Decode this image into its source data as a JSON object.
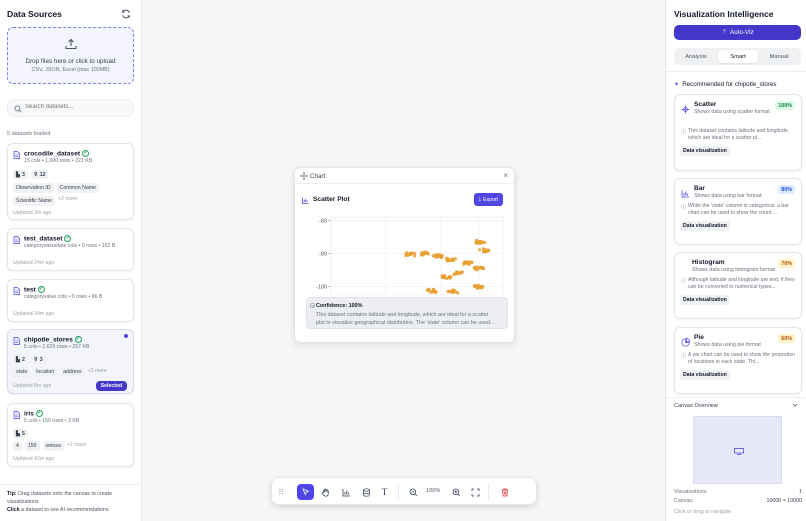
{
  "left_panel": {
    "title": "Data Sources",
    "upload": {
      "text": "Drop files here or click to upload",
      "formats": "CSV, JSON, Excel (max 100MB)"
    },
    "search": {
      "placeholder": "Search datasets..."
    },
    "loaded_count": "5 datasets loaded",
    "datasets": [
      {
        "name": "crocodile_dataset",
        "meta": "15 cols • 1,000 rows • 221 KB",
        "chip_a": "3",
        "chip_b": "12",
        "tags": [
          "Observation ID",
          "Common Name",
          "Scientific Name"
        ],
        "more": "+2 more",
        "updated": "Updated 3m ago"
      },
      {
        "name": "test_dataset",
        "meta": "categoryvaluedate cols • 0 rows • 162 B",
        "updated": "Updated 24m ago"
      },
      {
        "name": "test",
        "meta": "categoryvalue cols • 0 rows • 96 B",
        "updated": "Updated 34m ago"
      },
      {
        "name": "chipotle_stores",
        "meta": "5 cols • 2,629 rows • 257 KB",
        "chip_a": "2",
        "chip_b": "3",
        "tags": [
          "state",
          "location",
          "address"
        ],
        "more": "+2 more",
        "updated": "Updated 8m ago",
        "selected_label": "Selected"
      },
      {
        "name": "iris",
        "meta": "5 cols • 150 rows • 3 KB",
        "chip_a": "5",
        "tags": [
          "4",
          "150",
          "setosa"
        ],
        "more": "+2 more",
        "updated": "Updated 42m ago"
      }
    ],
    "tip_bold": "Tip:",
    "tip_text": " Drag datasets onto the canvas to create visualizations",
    "tip2_bold": "Click",
    "tip2_text": " a dataset to see AI recommendations"
  },
  "chart_window": {
    "title": "Chart",
    "chart_title": "Scatter Plot",
    "export_label": "Export",
    "confidence": "Confidence: 100%",
    "explanation_1": "This dataset contains latitude and longitude, which are ideal for a scatter",
    "explanation_2": "plot to visualize geographical distribution. The 'state' column can be used..."
  },
  "chart_data": {
    "type": "scatter",
    "ylim": [
      -105,
      -58
    ],
    "y_ticks": [
      "-60",
      "-80",
      "-100"
    ],
    "point_color": "#e8a030",
    "clusters": [
      {
        "x": 0.46,
        "y": -80.5
      },
      {
        "x": 0.55,
        "y": -80.0
      },
      {
        "x": 0.62,
        "y": -81.5
      },
      {
        "x": 0.7,
        "y": -83.5
      },
      {
        "x": 0.8,
        "y": -86.0
      },
      {
        "x": 0.87,
        "y": -73.0
      },
      {
        "x": 0.89,
        "y": -78.0
      },
      {
        "x": 0.86,
        "y": -89.0
      },
      {
        "x": 0.74,
        "y": -92.0
      },
      {
        "x": 0.67,
        "y": -94.0
      },
      {
        "x": 0.86,
        "y": -100.0
      },
      {
        "x": 0.71,
        "y": -103.0
      },
      {
        "x": 0.59,
        "y": -102.5
      }
    ]
  },
  "toolbar": {
    "zoom": "100%"
  },
  "right_panel": {
    "title": "Visualization Intelligence",
    "autoviz_label": "Auto-Viz",
    "tabs": [
      "Analysis",
      "Smart",
      "Manual"
    ],
    "recommended_header": "Recommended for chipotle_stores",
    "recommendations": [
      {
        "name": "Scatter",
        "subtitle": "Shows data using scatter format",
        "pct": "100%",
        "note": "This dataset contains latitude and longitude, which are ideal for a scatter pl...",
        "button": "Data visualization",
        "pct_bg": "#dcfce7",
        "pct_fg": "#15803d"
      },
      {
        "name": "Bar",
        "subtitle": "Shows data using bar format",
        "pct": "80%",
        "note": "While the 'state' column is categorical, a bar chart can be used to show the count ...",
        "button": "Data visualization",
        "pct_bg": "#dbeafe",
        "pct_fg": "#1d4ed8"
      },
      {
        "name": "Histogram",
        "subtitle": "Shows data using histogram format",
        "pct": "70%",
        "note": "Although latitude and longitude are text, if they can be converted to numerical types...",
        "button": "Data visualization",
        "pct_bg": "#fef3c7",
        "pct_fg": "#b45309"
      },
      {
        "name": "Pie",
        "subtitle": "Shows data using pie format",
        "pct": "60%",
        "note": "A pie chart can be used to show the proportion of locations in each state. Thi...",
        "button": "Data visualization",
        "pct_bg": "#fef3c7",
        "pct_fg": "#b45309"
      }
    ],
    "overview_title": "Canvas Overview",
    "stats": [
      {
        "label": "Visualizations:",
        "value": "1"
      },
      {
        "label": "Canvas:",
        "value": "10000 × 10000"
      }
    ],
    "nav_hint": "Click or drag to navigate"
  },
  "colors": {
    "accent": "#4f46e5",
    "accent_dark": "#4338ca"
  }
}
